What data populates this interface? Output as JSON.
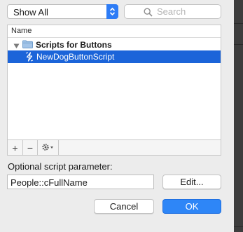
{
  "filter": {
    "selected": "Show All"
  },
  "search": {
    "placeholder": "Search",
    "value": ""
  },
  "list": {
    "column_header": "Name",
    "folder": {
      "label": "Scripts for Buttons",
      "expanded": true
    },
    "scripts": [
      {
        "label": "NewDogButtonScript",
        "selected": true
      }
    ]
  },
  "toolbar": {
    "add": "+",
    "remove": "−"
  },
  "parameter": {
    "label": "Optional script parameter:",
    "value": "People::cFullName"
  },
  "buttons": {
    "edit": "Edit...",
    "cancel": "Cancel",
    "ok": "OK"
  },
  "colors": {
    "accent": "#2e86f7",
    "selection": "#1b64d9",
    "stepper": "#2d7cf6"
  }
}
